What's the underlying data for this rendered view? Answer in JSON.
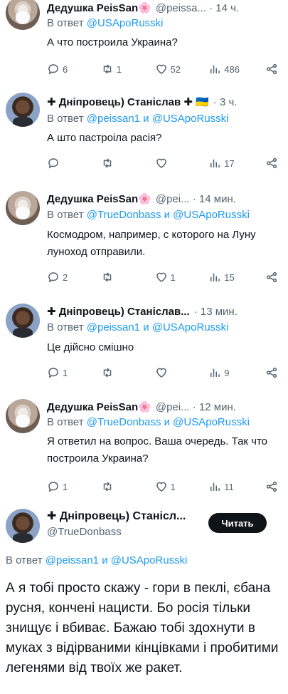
{
  "tweets": [
    {
      "name": "Дедушка PeisSan",
      "name_suffix": "🌸",
      "handle": "@peissa... · 14 ч.",
      "reply_prefix": "В ответ ",
      "reply_to": "@USApoRusski",
      "text": "А что построила Украина?",
      "replies": "6",
      "retweets": "1",
      "likes": "52",
      "views": "486"
    },
    {
      "name": "✚ Дніпровець) Станіслав ✚ 🇺🇦",
      "handle": "· 3 ч.",
      "reply_prefix": "В ответ ",
      "reply_to": "@peissan1 и @USApoRusski",
      "text": "А што пастроіла расія?",
      "replies": "",
      "retweets": "",
      "likes": "",
      "views": "17"
    },
    {
      "name": "Дедушка PeisSan",
      "name_suffix": "🌸",
      "handle": "@pei... · 14 мин.",
      "reply_prefix": "В ответ ",
      "reply_to": "@TrueDonbass и @USApoRusski",
      "text": "Космодром, например, с которого на Луну луноход отправили.",
      "replies": "2",
      "retweets": "",
      "likes": "1",
      "views": "15"
    },
    {
      "name": "✚ Дніпровець) Станіслав...",
      "handle": "· 13 мин.",
      "reply_prefix": "В ответ ",
      "reply_to": "@peissan1 и @USApoRusski",
      "text": "Це дійсно смішно",
      "replies": "1",
      "retweets": "",
      "likes": "",
      "views": "9"
    },
    {
      "name": "Дедушка PeisSan",
      "name_suffix": "🌸",
      "handle": "@pei... · 12 мин.",
      "reply_prefix": "В ответ ",
      "reply_to": "@TrueDonbass и @USApoRusski",
      "text": "Я ответил на вопрос. Ваша очередь. Так что построила Украина?",
      "replies": "1",
      "retweets": "",
      "likes": "1",
      "views": "11"
    }
  ],
  "main_tweet": {
    "name": "✚ Дніпровець) Станісл...",
    "handle": "@TrueDonbass",
    "follow_label": "Читать",
    "reply_prefix": "В ответ ",
    "reply_to": "@peissan1 и @USApoRusski",
    "text": "А я тобі просто скажу - гори в пеклі, єбана русня, кончені нацисти. Бо росія тільки знищує і вбиває. Бажаю тобі здохнути в муках з відірваними кінцівками і пробитими легенями від твоїх же ракет."
  },
  "colors": {
    "link": "#1d9bf0",
    "muted": "#536471",
    "text": "#0f1419"
  }
}
